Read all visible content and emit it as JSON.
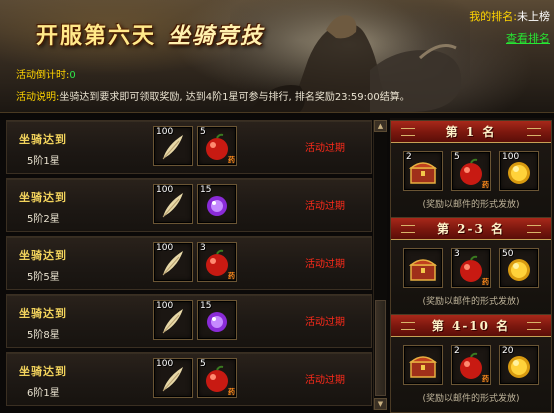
{
  "header": {
    "title_main": "开服第六天",
    "title_sub": "坐骑竞技",
    "rank_label": "我的排名:",
    "rank_value": "未上榜",
    "view_rank": "查看排名"
  },
  "info": {
    "countdown_label": "活动倒计时:",
    "countdown_value": "0",
    "desc_label": "活动说明:",
    "desc_text": "坐骑达到要求即可领取奖励, 达到4阶1星可参与排行, 排名奖励23:59:00结算。"
  },
  "rewards": [
    {
      "title": "坐骑达到",
      "req": "5阶1星",
      "items": [
        {
          "count": "100",
          "icon": "feather-icon"
        },
        {
          "count": "5",
          "icon": "red-fruit-icon",
          "tag": "药"
        }
      ],
      "status": "活动过期"
    },
    {
      "title": "坐骑达到",
      "req": "5阶2星",
      "items": [
        {
          "count": "100",
          "icon": "feather-icon"
        },
        {
          "count": "15",
          "icon": "purple-orb-icon"
        }
      ],
      "status": "活动过期"
    },
    {
      "title": "坐骑达到",
      "req": "5阶5星",
      "items": [
        {
          "count": "100",
          "icon": "feather-icon"
        },
        {
          "count": "3",
          "icon": "red-fruit-icon",
          "tag": "药"
        }
      ],
      "status": "活动过期"
    },
    {
      "title": "坐骑达到",
      "req": "5阶8星",
      "items": [
        {
          "count": "100",
          "icon": "feather-icon"
        },
        {
          "count": "15",
          "icon": "purple-orb-icon"
        }
      ],
      "status": "活动过期"
    },
    {
      "title": "坐骑达到",
      "req": "6阶1星",
      "items": [
        {
          "count": "100",
          "icon": "feather-icon"
        },
        {
          "count": "5",
          "icon": "red-fruit-icon",
          "tag": "药"
        }
      ],
      "status": "活动过期"
    }
  ],
  "rank_rewards": [
    {
      "header": "第 1 名",
      "items": [
        {
          "count": "2",
          "icon": "treasure-chest-icon"
        },
        {
          "count": "5",
          "icon": "red-fruit-icon",
          "tag": "药"
        },
        {
          "count": "100",
          "icon": "gold-ingot-icon"
        }
      ],
      "note": "(奖励以邮件的形式发放)"
    },
    {
      "header": "第 2-3 名",
      "items": [
        {
          "count": "",
          "icon": "treasure-chest-icon"
        },
        {
          "count": "3",
          "icon": "red-fruit-icon",
          "tag": "药"
        },
        {
          "count": "50",
          "icon": "gold-ingot-icon"
        }
      ],
      "note": "(奖励以邮件的形式发放)"
    },
    {
      "header": "第 4-10 名",
      "items": [
        {
          "count": "",
          "icon": "treasure-chest-icon"
        },
        {
          "count": "2",
          "icon": "red-fruit-icon",
          "tag": "药"
        },
        {
          "count": "20",
          "icon": "gold-ingot-icon"
        }
      ],
      "note": "(奖励以邮件的形式发放)"
    }
  ],
  "scrollbar": {
    "up": "▲",
    "down": "▼"
  }
}
